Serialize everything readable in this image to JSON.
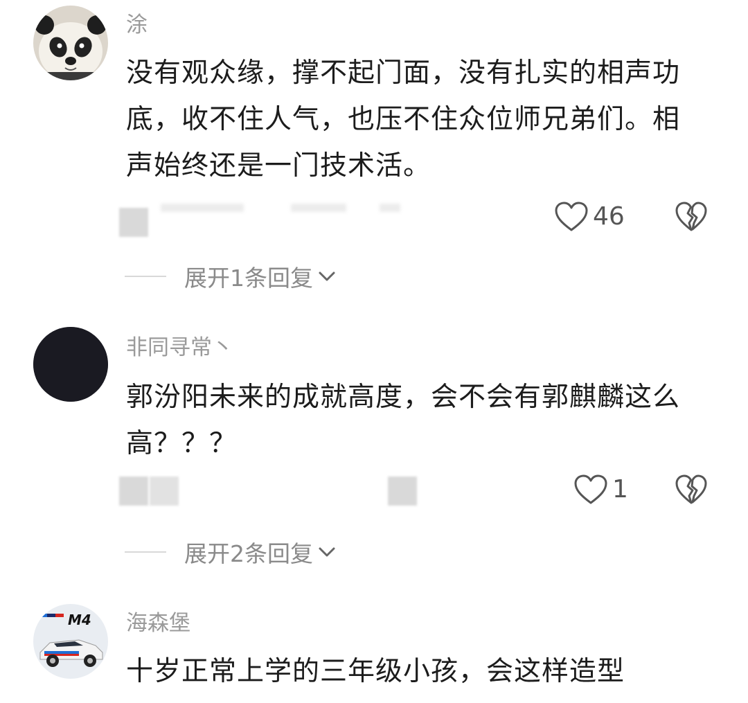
{
  "comments": [
    {
      "username": "涂",
      "avatar": "panda-avatar",
      "text": "没有观众缘，撑不起门面，没有扎实的相声功底，收不住人气，也压不住众位师兄弟们。相声始终还是一门技术活。",
      "likes": "46",
      "replies_label": "展开1条回复"
    },
    {
      "username": "非同寻常丶",
      "avatar": "dark-avatar",
      "text": "郭汾阳未来的成就高度，会不会有郭麒麟这么高？？？",
      "likes": "1",
      "replies_label": "展开2条回复"
    },
    {
      "username": "海森堡",
      "avatar": "bmw-m4-car-avatar",
      "text": "十岁正常上学的三年级小孩，会这样造型"
    }
  ],
  "icons": {
    "like": "heart-outline-icon",
    "dislike": "broken-heart-icon",
    "expand": "chevron-down-icon"
  },
  "colors": {
    "text": "#1c1c1c",
    "username": "#9a9a9a",
    "secondary": "#8a8a8a",
    "icon": "#555555"
  }
}
